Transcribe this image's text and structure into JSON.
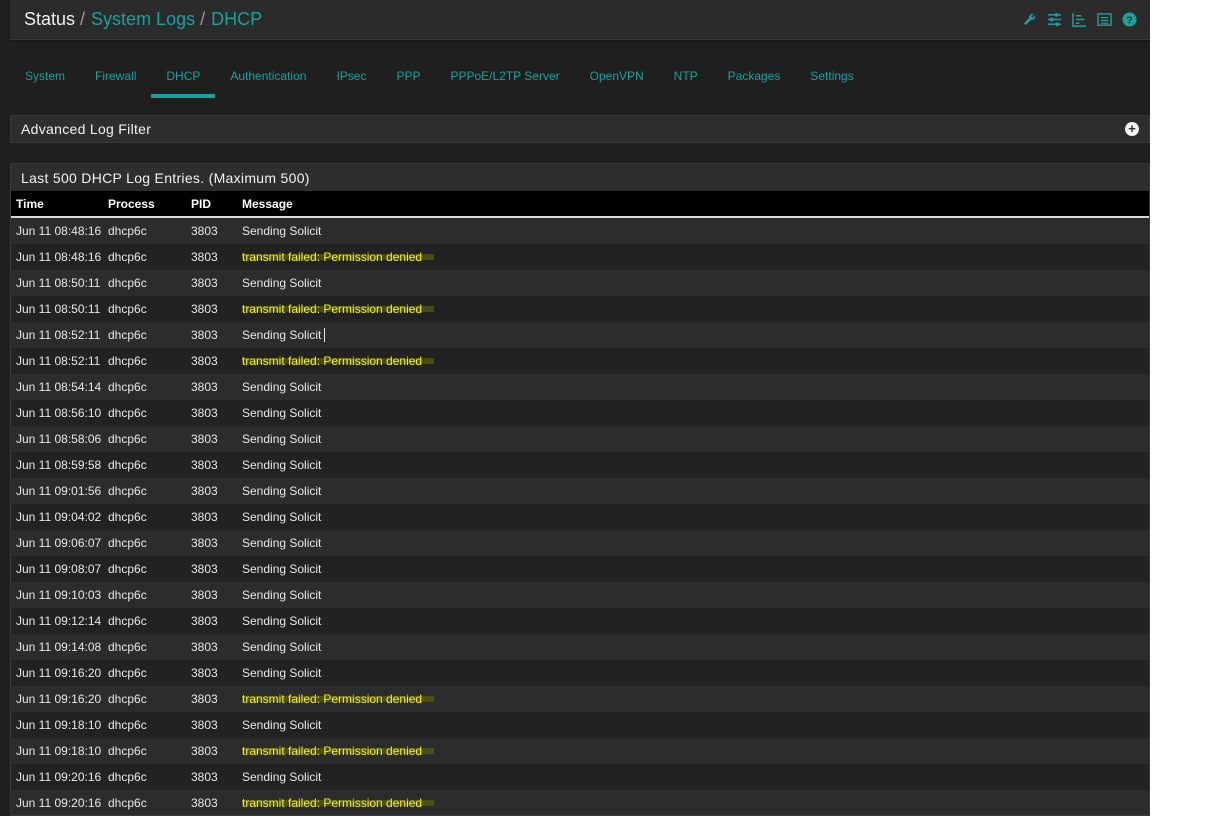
{
  "breadcrumb": {
    "root": "Status",
    "section": "System Logs",
    "current": "DHCP",
    "separator": "/"
  },
  "toolbar_icons": [
    "wrench-icon",
    "sliders-icon",
    "chart-icon",
    "list-icon",
    "help-icon"
  ],
  "tabs": [
    {
      "label": "System"
    },
    {
      "label": "Firewall"
    },
    {
      "label": "DHCP",
      "active": true
    },
    {
      "label": "Authentication"
    },
    {
      "label": "IPsec"
    },
    {
      "label": "PPP"
    },
    {
      "label": "PPPoE/L2TP Server"
    },
    {
      "label": "OpenVPN"
    },
    {
      "label": "NTP"
    },
    {
      "label": "Packages"
    },
    {
      "label": "Settings"
    }
  ],
  "filter_panel": {
    "title": "Advanced Log Filter"
  },
  "log_panel": {
    "title": "Last 500 DHCP Log Entries. (Maximum 500)",
    "columns": [
      "Time",
      "Process",
      "PID",
      "Message"
    ],
    "rows": [
      {
        "time": "Jun 11 08:48:16",
        "process": "dhcp6c",
        "pid": "3803",
        "message": "Sending Solicit"
      },
      {
        "time": "Jun 11 08:48:16",
        "process": "dhcp6c",
        "pid": "3803",
        "message": "transmit failed: Permission denied",
        "highlight": true
      },
      {
        "time": "Jun 11 08:50:11",
        "process": "dhcp6c",
        "pid": "3803",
        "message": "Sending Solicit"
      },
      {
        "time": "Jun 11 08:50:11",
        "process": "dhcp6c",
        "pid": "3803",
        "message": "transmit failed: Permission denied",
        "highlight": true
      },
      {
        "time": "Jun 11 08:52:11",
        "process": "dhcp6c",
        "pid": "3803",
        "message": "Sending Solicit",
        "cursor": true
      },
      {
        "time": "Jun 11 08:52:11",
        "process": "dhcp6c",
        "pid": "3803",
        "message": "transmit failed: Permission denied",
        "highlight": true
      },
      {
        "time": "Jun 11 08:54:14",
        "process": "dhcp6c",
        "pid": "3803",
        "message": "Sending Solicit"
      },
      {
        "time": "Jun 11 08:56:10",
        "process": "dhcp6c",
        "pid": "3803",
        "message": "Sending Solicit"
      },
      {
        "time": "Jun 11 08:58:06",
        "process": "dhcp6c",
        "pid": "3803",
        "message": "Sending Solicit"
      },
      {
        "time": "Jun 11 08:59:58",
        "process": "dhcp6c",
        "pid": "3803",
        "message": "Sending Solicit"
      },
      {
        "time": "Jun 11 09:01:56",
        "process": "dhcp6c",
        "pid": "3803",
        "message": "Sending Solicit"
      },
      {
        "time": "Jun 11 09:04:02",
        "process": "dhcp6c",
        "pid": "3803",
        "message": "Sending Solicit"
      },
      {
        "time": "Jun 11 09:06:07",
        "process": "dhcp6c",
        "pid": "3803",
        "message": "Sending Solicit"
      },
      {
        "time": "Jun 11 09:08:07",
        "process": "dhcp6c",
        "pid": "3803",
        "message": "Sending Solicit"
      },
      {
        "time": "Jun 11 09:10:03",
        "process": "dhcp6c",
        "pid": "3803",
        "message": "Sending Solicit"
      },
      {
        "time": "Jun 11 09:12:14",
        "process": "dhcp6c",
        "pid": "3803",
        "message": "Sending Solicit"
      },
      {
        "time": "Jun 11 09:14:08",
        "process": "dhcp6c",
        "pid": "3803",
        "message": "Sending Solicit"
      },
      {
        "time": "Jun 11 09:16:20",
        "process": "dhcp6c",
        "pid": "3803",
        "message": "Sending Solicit"
      },
      {
        "time": "Jun 11 09:16:20",
        "process": "dhcp6c",
        "pid": "3803",
        "message": "transmit failed: Permission denied",
        "highlight": true
      },
      {
        "time": "Jun 11 09:18:10",
        "process": "dhcp6c",
        "pid": "3803",
        "message": "Sending Solicit"
      },
      {
        "time": "Jun 11 09:18:10",
        "process": "dhcp6c",
        "pid": "3803",
        "message": "transmit failed: Permission denied",
        "highlight": true
      },
      {
        "time": "Jun 11 09:20:16",
        "process": "dhcp6c",
        "pid": "3803",
        "message": "Sending Solicit"
      },
      {
        "time": "Jun 11 09:20:16",
        "process": "dhcp6c",
        "pid": "3803",
        "message": "transmit failed: Permission denied",
        "highlight": true
      }
    ]
  },
  "colors": {
    "accent": "#17a2a0",
    "highlight_text": "#f3f313",
    "background": "#1f1f1f"
  }
}
